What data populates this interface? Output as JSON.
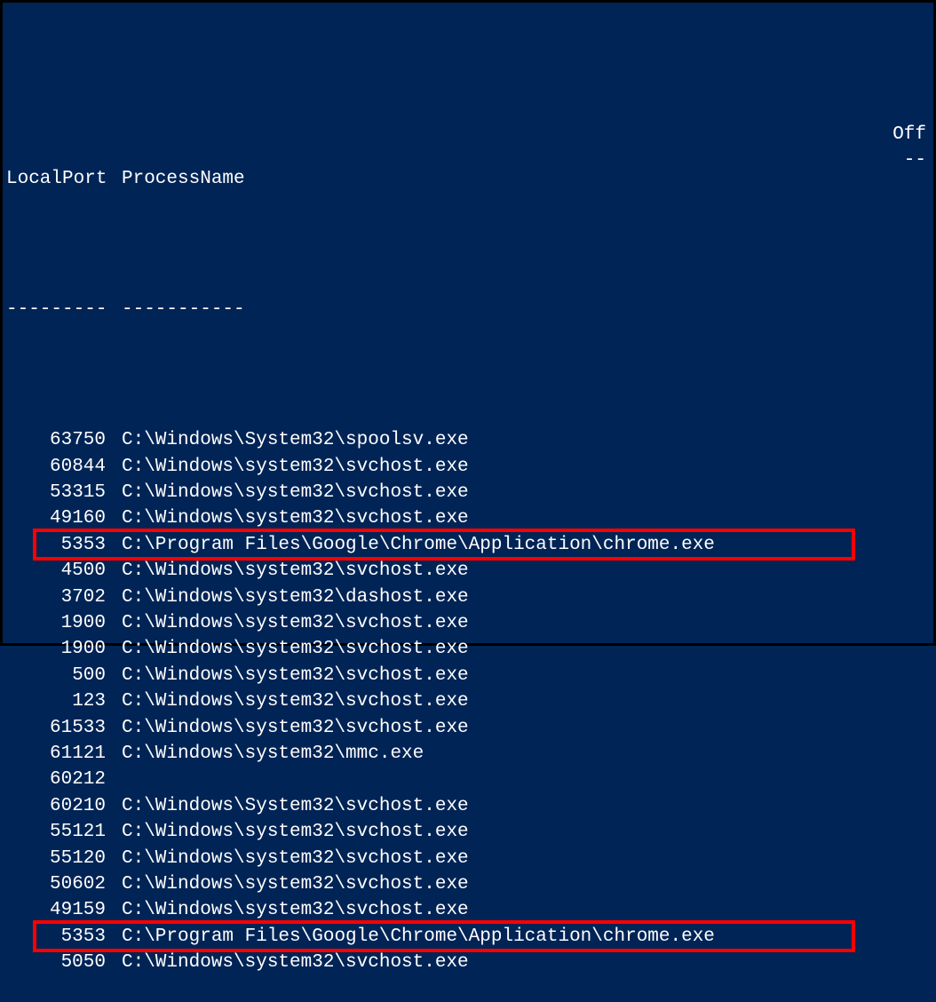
{
  "headers": {
    "localPort": "LocalPort",
    "processName": "ProcessName",
    "off": "Off"
  },
  "separators": {
    "localPort": "---------",
    "processName": "-----------",
    "off": "--"
  },
  "rows": [
    {
      "port": "63750",
      "process": "C:\\Windows\\System32\\spoolsv.exe",
      "highlighted": false
    },
    {
      "port": "60844",
      "process": "C:\\Windows\\system32\\svchost.exe",
      "highlighted": false
    },
    {
      "port": "53315",
      "process": "C:\\Windows\\system32\\svchost.exe",
      "highlighted": false
    },
    {
      "port": "49160",
      "process": "C:\\Windows\\system32\\svchost.exe",
      "highlighted": false
    },
    {
      "port": "5353",
      "process": "C:\\Program Files\\Google\\Chrome\\Application\\chrome.exe",
      "highlighted": true
    },
    {
      "port": "4500",
      "process": "C:\\Windows\\system32\\svchost.exe",
      "highlighted": false
    },
    {
      "port": "3702",
      "process": "C:\\Windows\\system32\\dashost.exe",
      "highlighted": false
    },
    {
      "port": "1900",
      "process": "C:\\Windows\\system32\\svchost.exe",
      "highlighted": false
    },
    {
      "port": "1900",
      "process": "C:\\Windows\\system32\\svchost.exe",
      "highlighted": false
    },
    {
      "port": "500",
      "process": "C:\\Windows\\system32\\svchost.exe",
      "highlighted": false
    },
    {
      "port": "123",
      "process": "C:\\Windows\\system32\\svchost.exe",
      "highlighted": false
    },
    {
      "port": "61533",
      "process": "C:\\Windows\\system32\\svchost.exe",
      "highlighted": false
    },
    {
      "port": "61121",
      "process": "C:\\Windows\\system32\\mmc.exe",
      "highlighted": false
    },
    {
      "port": "60212",
      "process": "",
      "highlighted": false
    },
    {
      "port": "60210",
      "process": "C:\\Windows\\System32\\svchost.exe",
      "highlighted": false
    },
    {
      "port": "55121",
      "process": "C:\\Windows\\system32\\svchost.exe",
      "highlighted": false
    },
    {
      "port": "55120",
      "process": "C:\\Windows\\system32\\svchost.exe",
      "highlighted": false
    },
    {
      "port": "50602",
      "process": "C:\\Windows\\system32\\svchost.exe",
      "highlighted": false
    },
    {
      "port": "49159",
      "process": "C:\\Windows\\system32\\svchost.exe",
      "highlighted": false
    },
    {
      "port": "5353",
      "process": "C:\\Program Files\\Google\\Chrome\\Application\\chrome.exe",
      "highlighted": true
    },
    {
      "port": "5050",
      "process": "C:\\Windows\\system32\\svchost.exe",
      "highlighted": false
    }
  ]
}
